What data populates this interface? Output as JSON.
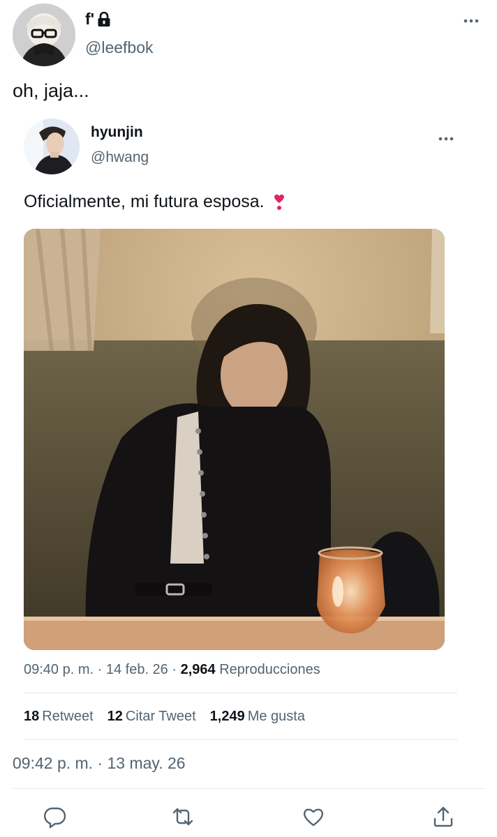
{
  "outer_tweet": {
    "name": "f'",
    "handle": "@leefbok",
    "text": "oh, jaja...",
    "timestamp": "09:42 p. m. · 13 may. 26"
  },
  "quoted_tweet": {
    "name": "hyunjin",
    "handle": "@hwang",
    "text": "Oficialmente, mi futura esposa.",
    "meta": {
      "time": "09:40 p. m. · 14 feb. 26 · ",
      "views_count": "2,964",
      "views_label": "Reproducciones"
    },
    "stats": {
      "retweets_count": "18",
      "retweets_label": "Retweet",
      "quotes_count": "12",
      "quotes_label": "Citar Tweet",
      "likes_count": "1,249",
      "likes_label": "Me gusta"
    }
  },
  "icons": {
    "lock": "lock-icon",
    "more": "more-dots-icon",
    "emoji": "heart-exclamation-icon",
    "reply": "reply-icon",
    "retweet": "retweet-icon",
    "like": "like-icon",
    "share": "share-icon"
  },
  "colors": {
    "text_primary": "#0f1419",
    "text_secondary": "#536471",
    "divider": "#e6ebef",
    "accent": "#1d9bf0",
    "emoji_red": "#e0245e"
  }
}
